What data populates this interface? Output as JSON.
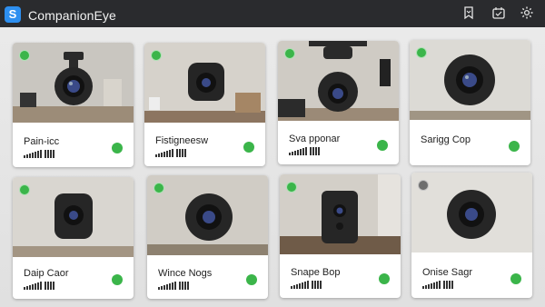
{
  "app": {
    "title": "CompanionEye",
    "logo_letter": "S"
  },
  "toolbar": {
    "icons": [
      "bookmark-icon",
      "calendar-icon",
      "gear-icon"
    ]
  },
  "colors": {
    "online": "#3bb54a",
    "accent": "#2d8ff0",
    "topbar": "#2a2b2e"
  },
  "cameras": [
    {
      "name": "Pain-icc",
      "status": "online"
    },
    {
      "name": "Fistigneesw",
      "status": "online"
    },
    {
      "name": "Sva pponar",
      "status": "online"
    },
    {
      "name": "Sarigg Cop",
      "status": "online"
    },
    {
      "name": "Daip Caor",
      "status": "online"
    },
    {
      "name": "Wince Nogs",
      "status": "online"
    },
    {
      "name": "Snape Bop",
      "status": "online"
    },
    {
      "name": "Onise Sagr",
      "status": "online"
    }
  ]
}
